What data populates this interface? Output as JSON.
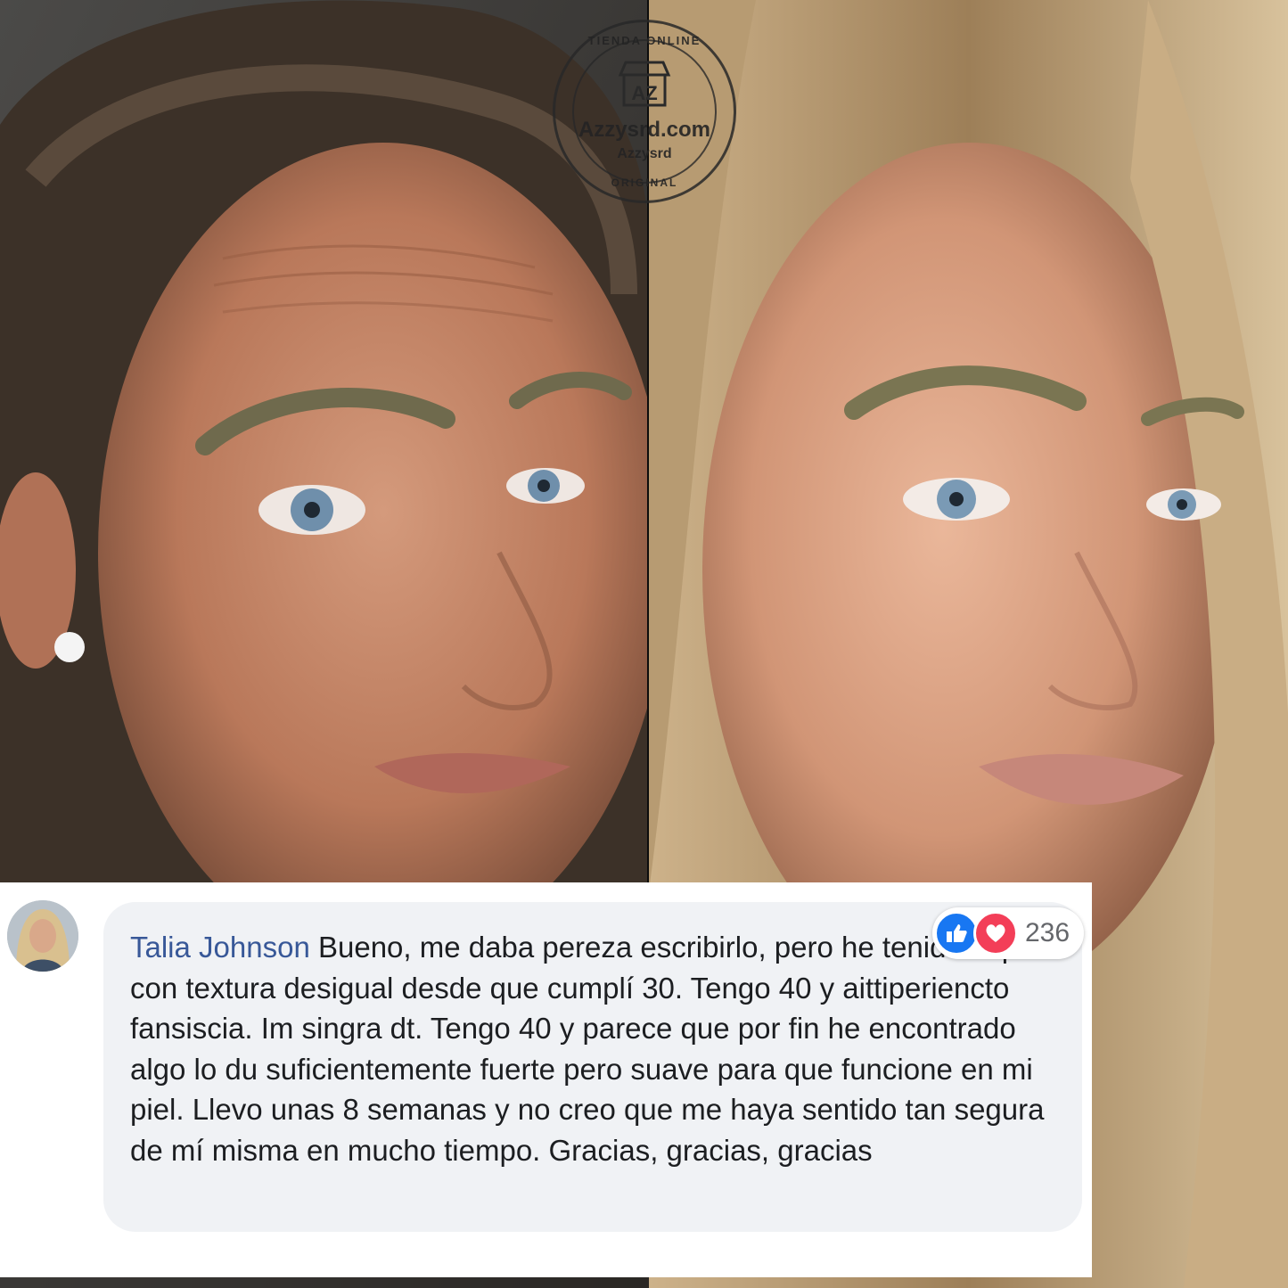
{
  "watermark": {
    "top_text": "TIENDA ONLINE",
    "logo_text": "AZ",
    "main_text": "Azzysrd.com",
    "sub_text": "Azzysrd",
    "bottom_text": "ORIGINAL"
  },
  "comment": {
    "author": "Talia Johnson",
    "text": "Bueno, me daba pereza escribirlo, pero he tenido la piel con textura desigual desde que cumplí 30. Tengo 40 y aittiperiencto fansiscia. Im singra dt. Tengo 40 y parece que por fin he encontrado algo lo du suficientemente fuerte pero suave para que funcione en mi piel. Llevo unas 8 semanas y no creo que me haya sentido tan segura de mí misma en mucho tiempo. Gracias, gracias, gracias",
    "reaction_count": "236",
    "reactions": [
      "like-icon",
      "love-icon"
    ]
  },
  "colors": {
    "author_link": "#385898",
    "like": "#1877f2",
    "love": "#f33e58",
    "bubble": "#f0f2f5"
  }
}
